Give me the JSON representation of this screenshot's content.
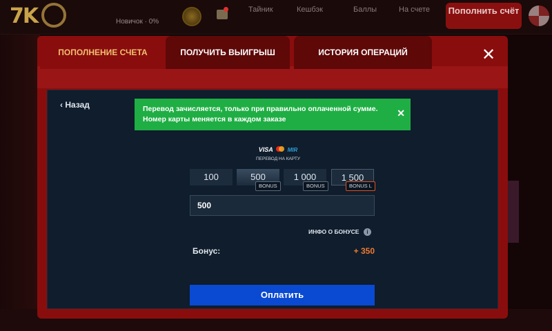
{
  "topbar": {
    "logo": "7K",
    "rank": "Новичок · 0%",
    "nav": [
      "Тайник",
      "Кешбэк",
      "Баллы",
      "На счете"
    ],
    "topup_label": "Пополнить счёт"
  },
  "modal": {
    "tabs": [
      {
        "label": "ПОПОЛНЕНИЕ СЧЕТА",
        "active": true
      },
      {
        "label": "ПОЛУЧИТЬ ВЫИГРЫШ",
        "active": false
      },
      {
        "label": "ИСТОРИЯ ОПЕРАЦИЙ",
        "active": false
      }
    ],
    "close_symbol": "✕",
    "back_label": "Назад",
    "alert_text": "Перевод зачисляется, только при правильно оплаченной сумме. Номер карты меняется в каждом заказе",
    "alert_close": "✕",
    "payment_method": {
      "brands": [
        "VISA",
        "MIR"
      ],
      "caption": "ПЕРЕВОД НА КАРТУ"
    },
    "amount_options": [
      {
        "value": "100",
        "tag": ""
      },
      {
        "value": "500",
        "tag": "BONUS",
        "selected": true
      },
      {
        "value": "1 000",
        "tag": "BONUS"
      },
      {
        "value": "1 500",
        "tag": "BONUS L"
      }
    ],
    "amount_input_value": "500",
    "bonus_info_label": "ИНФО О БОНУСЕ",
    "bonus_label": "Бонус:",
    "bonus_value": "+ 350",
    "pay_label": "Оплатить"
  },
  "colors": {
    "accent": "#8a0d0d",
    "active_tab": "#f0c070",
    "success": "#1fae44",
    "primary_button": "#0a4ad2",
    "bonus": "#f07a30"
  }
}
